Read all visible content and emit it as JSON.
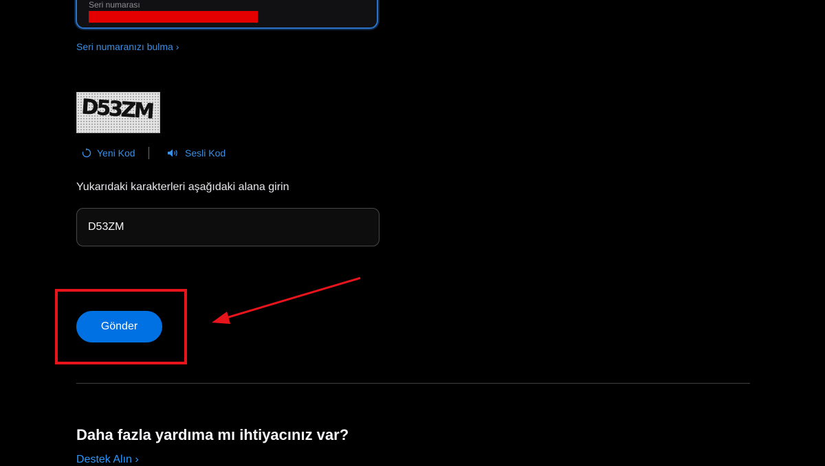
{
  "serial": {
    "label": "Seri numarası",
    "find_link": "Seri numaranızı bulma ›"
  },
  "captcha": {
    "image_text": "D53ZM",
    "new_code_label": "Yeni Kod",
    "audio_code_label": "Sesli Kod",
    "instructions": "Yukarıdaki karakterleri aşağıdaki alana girin",
    "input_value": "D53ZM"
  },
  "submit_label": "Gönder",
  "help": {
    "heading": "Daha fazla yardıma mı ihtiyacınız var?",
    "support_link": "Destek Alın ›"
  },
  "colors": {
    "background": "#000000",
    "accent": "#0071e3",
    "link": "#2997ff",
    "annotation": "#e8141c"
  },
  "icons": {
    "refresh": "refresh-icon",
    "speaker": "speaker-icon"
  }
}
